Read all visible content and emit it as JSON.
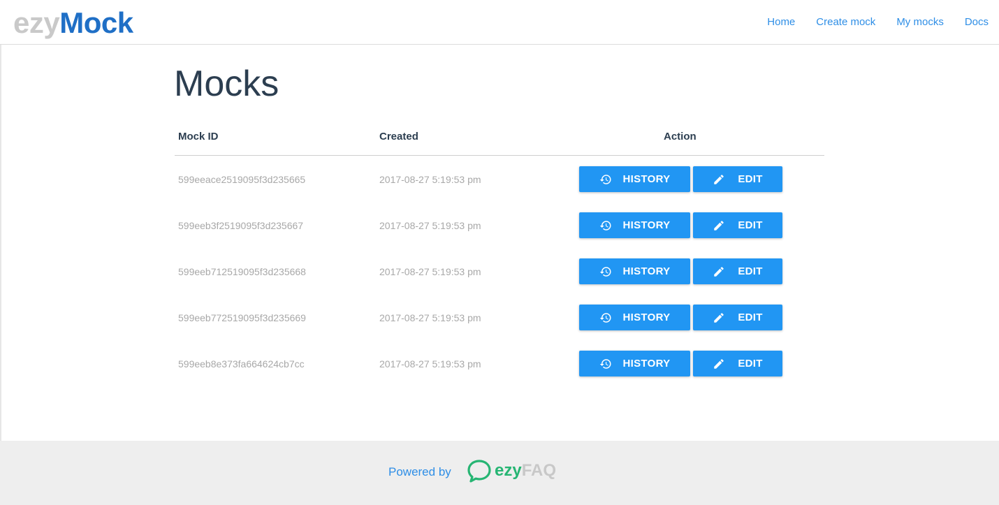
{
  "brand": {
    "part1": "ezy",
    "part2": "Mock"
  },
  "nav": [
    {
      "label": "Home"
    },
    {
      "label": "Create mock"
    },
    {
      "label": "My mocks"
    },
    {
      "label": "Docs"
    }
  ],
  "page": {
    "title": "Mocks"
  },
  "table": {
    "headers": {
      "id": "Mock ID",
      "created": "Created",
      "action": "Action"
    },
    "rows": [
      {
        "id": "599eeace2519095f3d235665",
        "created": "2017-08-27 5:19:53 pm",
        "history_label": "HISTORY",
        "edit_label": "EDIT"
      },
      {
        "id": "599eeb3f2519095f3d235667",
        "created": "2017-08-27 5:19:53 pm",
        "history_label": "HISTORY",
        "edit_label": "EDIT"
      },
      {
        "id": "599eeb712519095f3d235668",
        "created": "2017-08-27 5:19:53 pm",
        "history_label": "HISTORY",
        "edit_label": "EDIT"
      },
      {
        "id": "599eeb772519095f3d235669",
        "created": "2017-08-27 5:19:53 pm",
        "history_label": "HISTORY",
        "edit_label": "EDIT"
      },
      {
        "id": "599eeb8e373fa664624cb7cc",
        "created": "2017-08-27 5:19:53 pm",
        "history_label": "HISTORY",
        "edit_label": "EDIT"
      }
    ]
  },
  "footer": {
    "powered_by": "Powered by",
    "logo_part1": "ezy",
    "logo_part2": "FAQ"
  },
  "icons": {
    "history": "history-icon",
    "edit": "pencil-icon",
    "faq": "chat-bubble-icon"
  },
  "colors": {
    "accent": "#2196f3",
    "link": "#2e8ee6",
    "brand_blue": "#1f6fc6",
    "faq_green": "#26b573"
  }
}
